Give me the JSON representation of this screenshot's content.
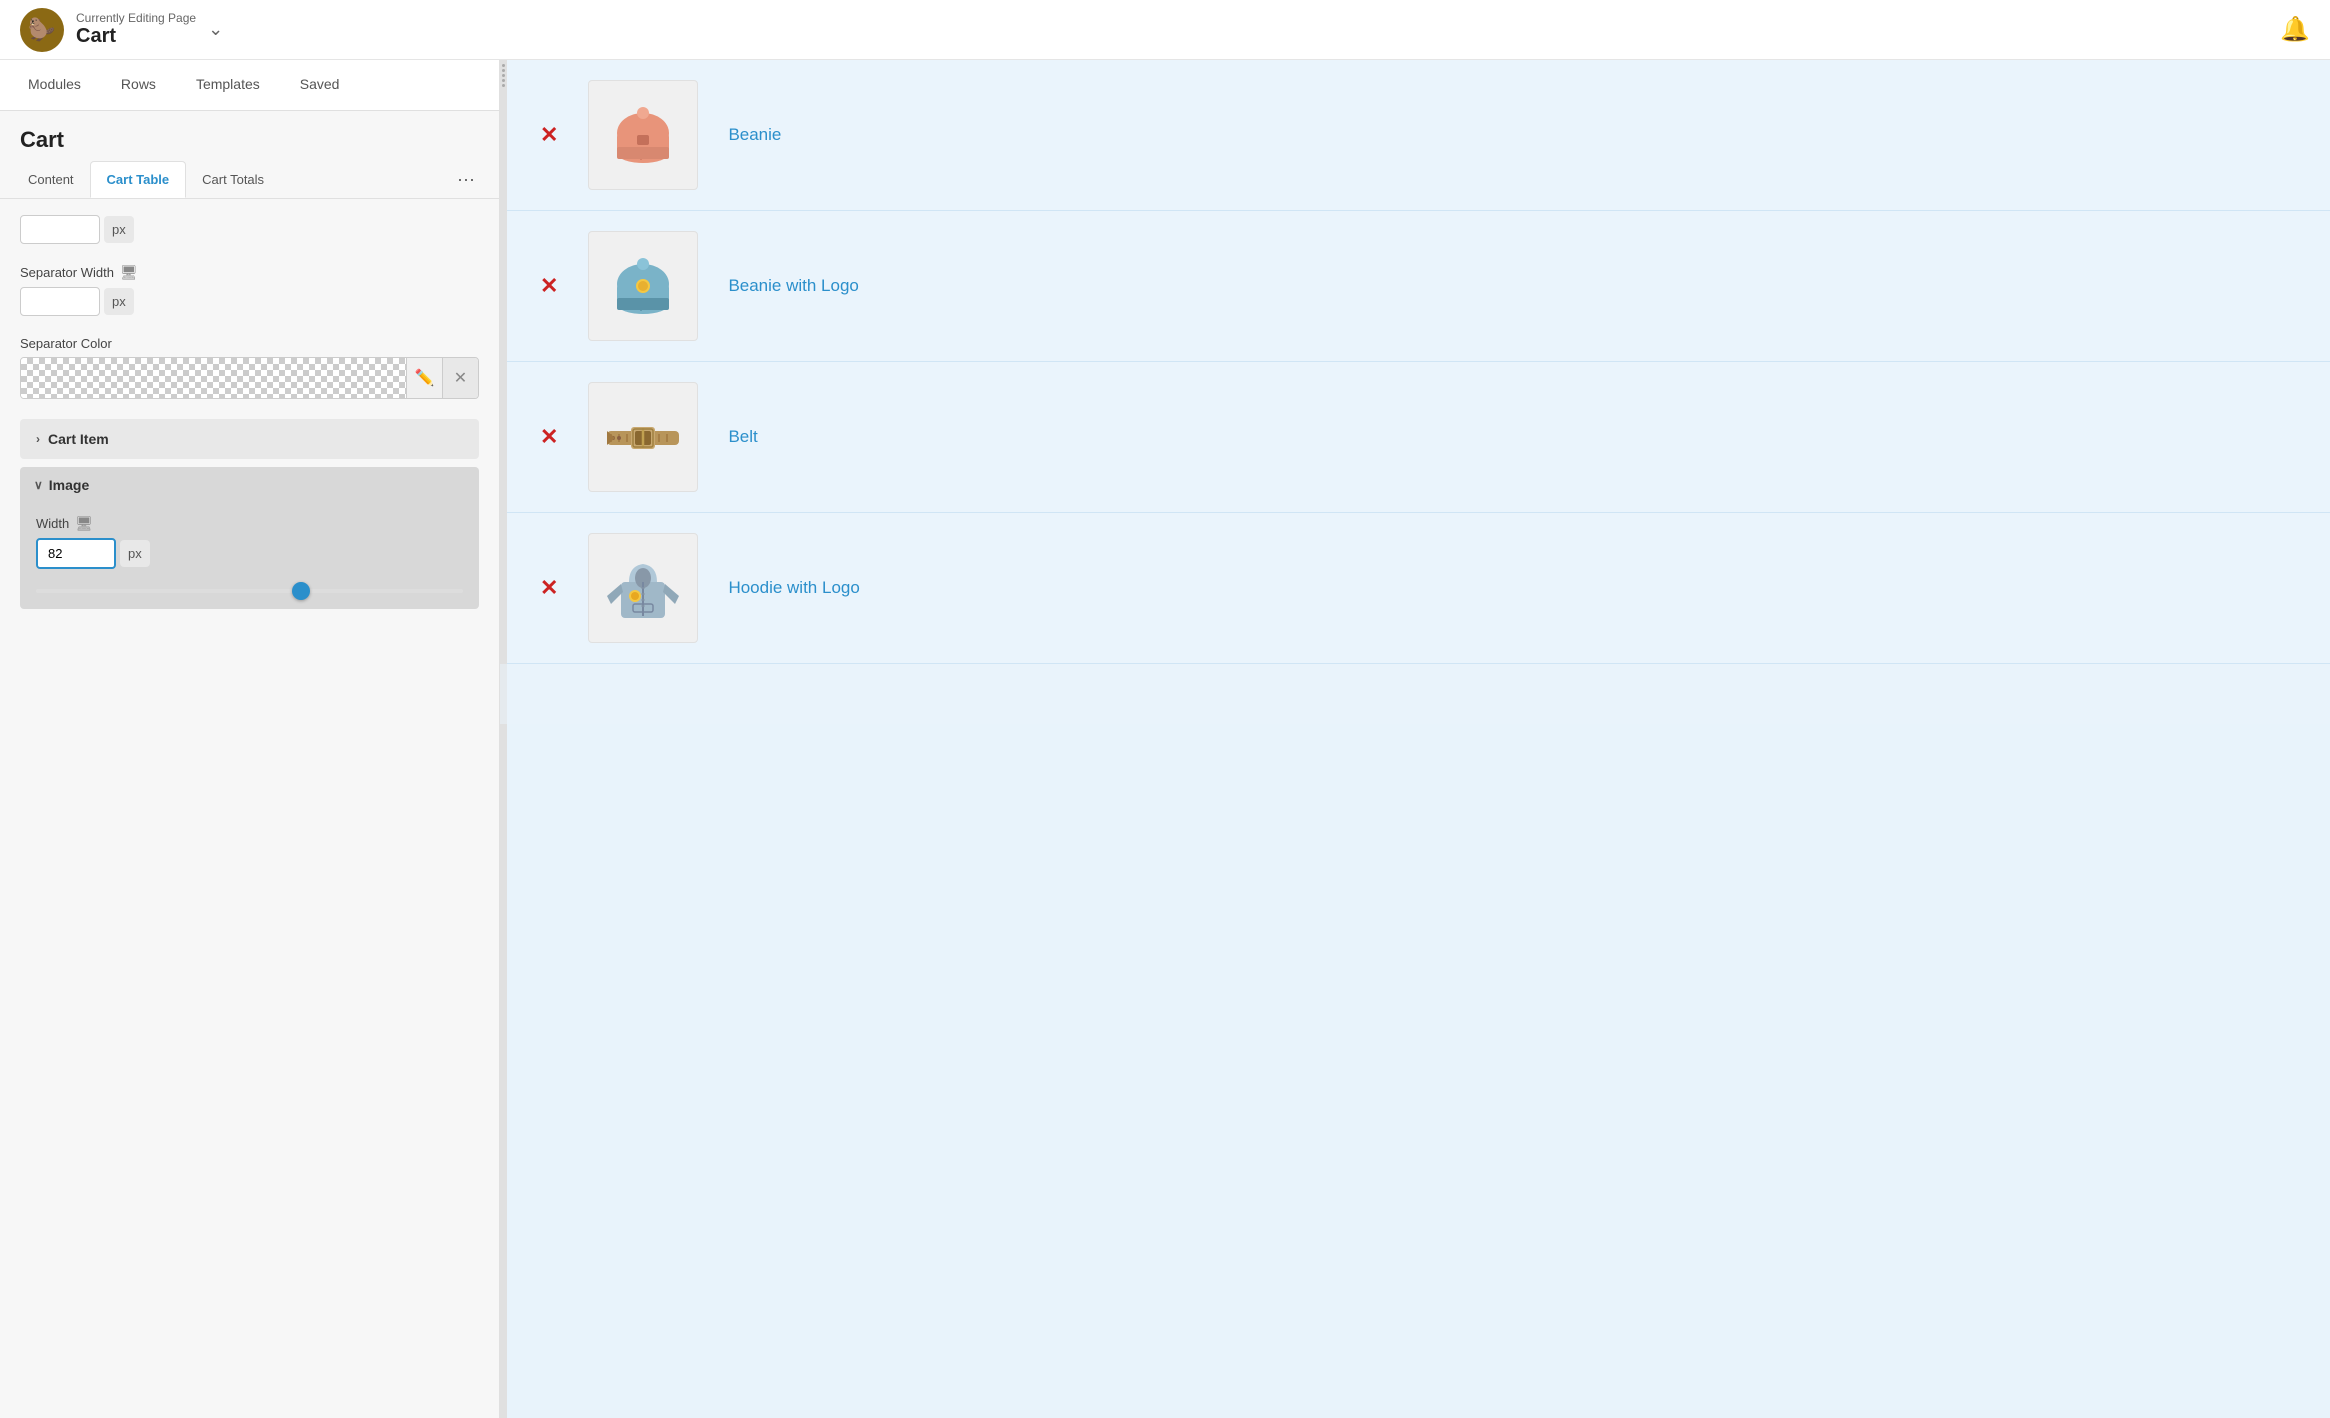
{
  "header": {
    "subtitle": "Currently Editing Page",
    "title": "Cart",
    "logo_emoji": "🦫",
    "chevron": "∨",
    "bell": "🔔"
  },
  "tabs": [
    {
      "id": "modules",
      "label": "Modules"
    },
    {
      "id": "rows",
      "label": "Rows"
    },
    {
      "id": "templates",
      "label": "Templates",
      "active": false
    },
    {
      "id": "saved",
      "label": "Saved"
    }
  ],
  "panel": {
    "title": "Cart"
  },
  "sub_tabs": [
    {
      "id": "content",
      "label": "Content"
    },
    {
      "id": "cart-table",
      "label": "Cart Table",
      "active": true
    },
    {
      "id": "cart-totals",
      "label": "Cart Totals"
    }
  ],
  "more_label": "···",
  "fields": {
    "separator_width_label": "Separator Width",
    "separator_color_label": "Separator Color",
    "px_unit": "px",
    "separator_width_value": "",
    "top_field_value": "",
    "image_width_value": "82",
    "image_width_label": "Width"
  },
  "accordions": {
    "cart_item": {
      "label": "Cart Item",
      "chevron": "›"
    },
    "image": {
      "label": "Image",
      "chevron": "∨"
    }
  },
  "slider": {
    "position_percent": 60
  },
  "cart_items": [
    {
      "id": "beanie",
      "name": "Beanie",
      "color": "#e8947a",
      "type": "beanie-pink"
    },
    {
      "id": "beanie-logo",
      "name": "Beanie with Logo",
      "color": "#7ab3c8",
      "type": "beanie-blue"
    },
    {
      "id": "belt",
      "name": "Belt",
      "color": "#b8955a",
      "type": "belt"
    },
    {
      "id": "hoodie",
      "name": "Hoodie with Logo",
      "color": "#a0b8c8",
      "type": "hoodie"
    }
  ]
}
